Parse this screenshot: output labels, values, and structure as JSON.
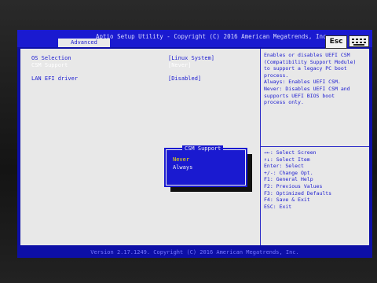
{
  "header": {
    "title": "Aptio Setup Utility - Copyright (C) 2016 American Megatrends, Inc.",
    "active_tab": "Advanced",
    "esc_label": "Esc",
    "keyboard_icon": "keyboard-icon"
  },
  "settings": [
    {
      "label": "OS Selection",
      "value": "[Linux System]"
    },
    {
      "label": "CSM Support",
      "value": "[Never]"
    },
    {
      "label": "LAN EFI driver",
      "value": "[Disabled]"
    }
  ],
  "help_text": "Enables or disables UEFI CSM\n(Compatibility Support Module)\nto support a legacy PC boot\nprocess.\nAlways: Enables UEFI CSM.\nNever: Disables UEFI CSM and\nsupports UEFI BIOS boot\nprocess only.",
  "key_legend": "→←: Select Screen\n↑↓: Select Item\nEnter: Select\n+/-: Change Opt.\nF1: General Help\nF2: Previous Values\nF3: Optimized Defaults\nF4: Save & Exit\nESC: Exit",
  "popup": {
    "title": "CSM Support",
    "options": [
      "Never",
      "Always"
    ],
    "selected": "Never"
  },
  "footer": "Version 2.17.1249. Copyright (C) 2016 American Megatrends, Inc.",
  "colors": {
    "bios_blue": "#1a1ad0",
    "pane_gray": "#e8e8e8",
    "highlight_yellow": "#f5e400"
  }
}
